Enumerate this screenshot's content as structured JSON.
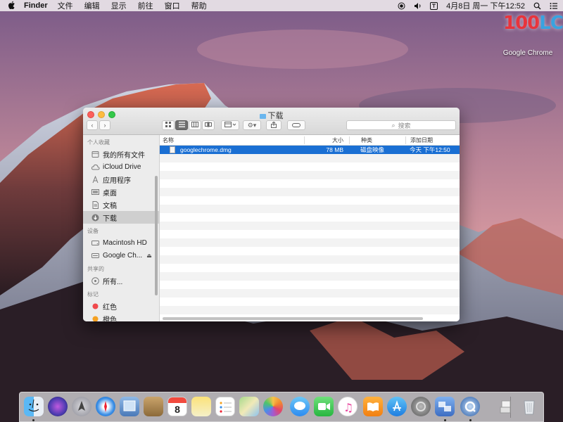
{
  "menubar": {
    "apple": "",
    "app_name": "Finder",
    "items": [
      "文件",
      "编辑",
      "显示",
      "前往",
      "窗口",
      "帮助"
    ],
    "clock": "4月8日 周一 下午12:52"
  },
  "desktop": {
    "icon_label": "Google Chrome",
    "icon_text_a": "100",
    "icon_text_b": "LC"
  },
  "finder": {
    "title": "下载",
    "search_placeholder": "搜索",
    "sidebar": {
      "favorites_header": "个人收藏",
      "favorites": [
        {
          "label": "我的所有文件",
          "icon": "all-files-icon"
        },
        {
          "label": "iCloud Drive",
          "icon": "cloud-icon"
        },
        {
          "label": "应用程序",
          "icon": "applications-icon"
        },
        {
          "label": "桌面",
          "icon": "desktop-icon"
        },
        {
          "label": "文稿",
          "icon": "documents-icon"
        },
        {
          "label": "下载",
          "icon": "downloads-icon"
        }
      ],
      "devices_header": "设备",
      "devices": [
        {
          "label": "Macintosh HD",
          "icon": "hard-drive-icon"
        },
        {
          "label": "Google Ch...",
          "icon": "disk-image-icon"
        }
      ],
      "shared_header": "共享的",
      "shared": [
        {
          "label": "所有...",
          "icon": "network-icon"
        }
      ],
      "tags_header": "标记",
      "tags": [
        {
          "label": "红色",
          "color": "#f0484b"
        },
        {
          "label": "橙色",
          "color": "#f5a122"
        }
      ]
    },
    "columns": {
      "name": "名称",
      "size": "大小",
      "kind": "种类",
      "date_added": "添加日期"
    },
    "files": [
      {
        "name": "googlechrome.dmg",
        "size": "78 MB",
        "kind": "磁盘映像",
        "date_added": "今天 下午12:50"
      }
    ]
  },
  "colors": {
    "selection": "#1a6fd3",
    "close": "#fc605c",
    "minimize": "#fdbc40",
    "zoom": "#34c84a"
  },
  "dock": {
    "calendar_day": "8",
    "apps": [
      "finder-icon",
      "siri-icon",
      "launchpad-icon",
      "safari-icon",
      "preview-icon",
      "contacts-icon",
      "calendar-icon",
      "notes-icon",
      "reminders-icon",
      "maps-icon",
      "photos-icon",
      "messages-icon",
      "facetime-icon",
      "itunes-icon",
      "ibooks-icon",
      "app-store-icon",
      "system-preferences-icon",
      "migration-icon",
      "quicktime-icon",
      "downloads-stack-icon",
      "trash-icon"
    ]
  }
}
